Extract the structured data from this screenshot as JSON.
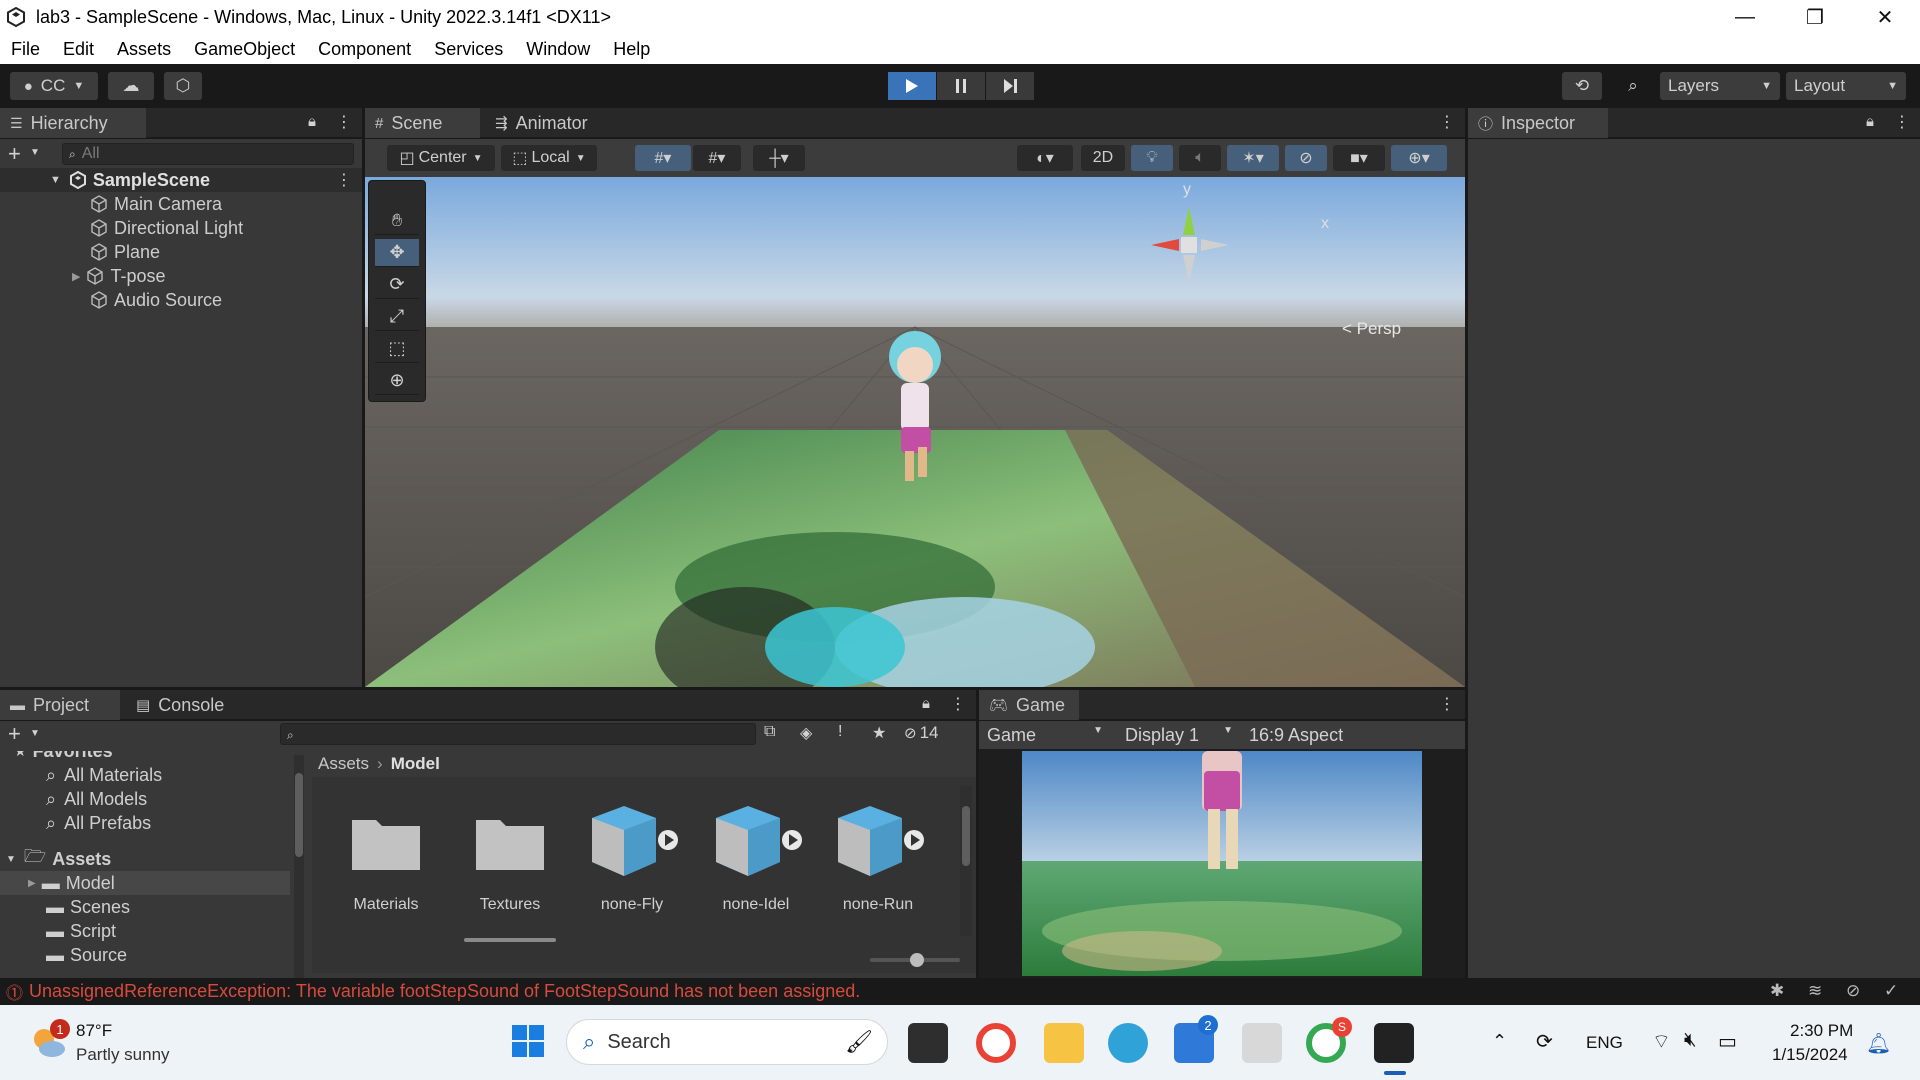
{
  "window": {
    "title": "lab3 - SampleScene - Windows, Mac, Linux - Unity 2022.3.14f1 <DX11>",
    "minimize_glyph": "—",
    "maximize_glyph": "❐",
    "close_glyph": "✕"
  },
  "menu": [
    "File",
    "Edit",
    "Assets",
    "GameObject",
    "Component",
    "Services",
    "Window",
    "Help"
  ],
  "toolbar": {
    "account_label": "CC",
    "layers_label": "Layers",
    "layout_label": "Layout"
  },
  "hierarchy": {
    "tab_label": "Hierarchy",
    "search_placeholder": "All",
    "scene_name": "SampleScene",
    "items": [
      "Main Camera",
      "Directional Light",
      "Plane",
      "T-pose",
      "Audio Source"
    ]
  },
  "scene_view": {
    "tabs": [
      "Scene",
      "Animator"
    ],
    "pivot_label": "Center",
    "space_label": "Local",
    "mode_2d_label": "2D",
    "gizmo_x": "x",
    "gizmo_y": "y",
    "persp_label": "< Persp"
  },
  "inspector": {
    "tab_label": "Inspector"
  },
  "project": {
    "tabs": [
      "Project",
      "Console"
    ],
    "favorites_label": "Favorites",
    "favorites": [
      "All Materials",
      "All Models",
      "All Prefabs"
    ],
    "assets_label": "Assets",
    "folders": [
      "Model",
      "Scenes",
      "Script",
      "Source"
    ],
    "breadcrumb_root": "Assets",
    "breadcrumb_current": "Model",
    "hidden_count": "14",
    "assets": [
      "Materials",
      "Textures",
      "none-Fly",
      "none-Idel",
      "none-Run"
    ]
  },
  "game_view": {
    "tab_label": "Game",
    "mode_label": "Game",
    "display_label": "Display 1",
    "aspect_label": "16:9 Aspect"
  },
  "status": {
    "error_message": "UnassignedReferenceException: The variable footStepSound of FootStepSound has not been assigned."
  },
  "taskbar": {
    "temperature": "87°F",
    "weather": "Partly sunny",
    "weather_badge": "1",
    "search_label": "Search",
    "mail_badge": "2",
    "chrome_badge": "S",
    "language": "ENG",
    "time": "2:30 PM",
    "date": "1/15/2024"
  }
}
